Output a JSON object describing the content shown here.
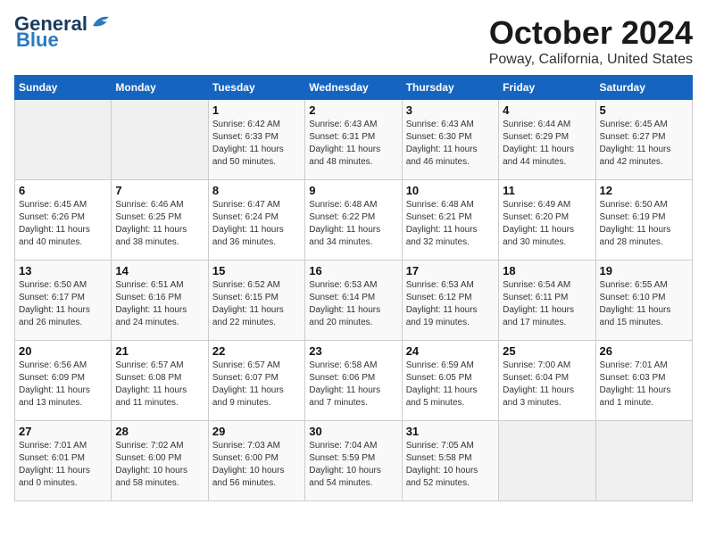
{
  "logo": {
    "line1": "General",
    "line2": "Blue"
  },
  "title": "October 2024",
  "subtitle": "Poway, California, United States",
  "days_of_week": [
    "Sunday",
    "Monday",
    "Tuesday",
    "Wednesday",
    "Thursday",
    "Friday",
    "Saturday"
  ],
  "weeks": [
    [
      {
        "day": "",
        "detail": ""
      },
      {
        "day": "",
        "detail": ""
      },
      {
        "day": "1",
        "detail": "Sunrise: 6:42 AM\nSunset: 6:33 PM\nDaylight: 11 hours\nand 50 minutes."
      },
      {
        "day": "2",
        "detail": "Sunrise: 6:43 AM\nSunset: 6:31 PM\nDaylight: 11 hours\nand 48 minutes."
      },
      {
        "day": "3",
        "detail": "Sunrise: 6:43 AM\nSunset: 6:30 PM\nDaylight: 11 hours\nand 46 minutes."
      },
      {
        "day": "4",
        "detail": "Sunrise: 6:44 AM\nSunset: 6:29 PM\nDaylight: 11 hours\nand 44 minutes."
      },
      {
        "day": "5",
        "detail": "Sunrise: 6:45 AM\nSunset: 6:27 PM\nDaylight: 11 hours\nand 42 minutes."
      }
    ],
    [
      {
        "day": "6",
        "detail": "Sunrise: 6:45 AM\nSunset: 6:26 PM\nDaylight: 11 hours\nand 40 minutes."
      },
      {
        "day": "7",
        "detail": "Sunrise: 6:46 AM\nSunset: 6:25 PM\nDaylight: 11 hours\nand 38 minutes."
      },
      {
        "day": "8",
        "detail": "Sunrise: 6:47 AM\nSunset: 6:24 PM\nDaylight: 11 hours\nand 36 minutes."
      },
      {
        "day": "9",
        "detail": "Sunrise: 6:48 AM\nSunset: 6:22 PM\nDaylight: 11 hours\nand 34 minutes."
      },
      {
        "day": "10",
        "detail": "Sunrise: 6:48 AM\nSunset: 6:21 PM\nDaylight: 11 hours\nand 32 minutes."
      },
      {
        "day": "11",
        "detail": "Sunrise: 6:49 AM\nSunset: 6:20 PM\nDaylight: 11 hours\nand 30 minutes."
      },
      {
        "day": "12",
        "detail": "Sunrise: 6:50 AM\nSunset: 6:19 PM\nDaylight: 11 hours\nand 28 minutes."
      }
    ],
    [
      {
        "day": "13",
        "detail": "Sunrise: 6:50 AM\nSunset: 6:17 PM\nDaylight: 11 hours\nand 26 minutes."
      },
      {
        "day": "14",
        "detail": "Sunrise: 6:51 AM\nSunset: 6:16 PM\nDaylight: 11 hours\nand 24 minutes."
      },
      {
        "day": "15",
        "detail": "Sunrise: 6:52 AM\nSunset: 6:15 PM\nDaylight: 11 hours\nand 22 minutes."
      },
      {
        "day": "16",
        "detail": "Sunrise: 6:53 AM\nSunset: 6:14 PM\nDaylight: 11 hours\nand 20 minutes."
      },
      {
        "day": "17",
        "detail": "Sunrise: 6:53 AM\nSunset: 6:12 PM\nDaylight: 11 hours\nand 19 minutes."
      },
      {
        "day": "18",
        "detail": "Sunrise: 6:54 AM\nSunset: 6:11 PM\nDaylight: 11 hours\nand 17 minutes."
      },
      {
        "day": "19",
        "detail": "Sunrise: 6:55 AM\nSunset: 6:10 PM\nDaylight: 11 hours\nand 15 minutes."
      }
    ],
    [
      {
        "day": "20",
        "detail": "Sunrise: 6:56 AM\nSunset: 6:09 PM\nDaylight: 11 hours\nand 13 minutes."
      },
      {
        "day": "21",
        "detail": "Sunrise: 6:57 AM\nSunset: 6:08 PM\nDaylight: 11 hours\nand 11 minutes."
      },
      {
        "day": "22",
        "detail": "Sunrise: 6:57 AM\nSunset: 6:07 PM\nDaylight: 11 hours\nand 9 minutes."
      },
      {
        "day": "23",
        "detail": "Sunrise: 6:58 AM\nSunset: 6:06 PM\nDaylight: 11 hours\nand 7 minutes."
      },
      {
        "day": "24",
        "detail": "Sunrise: 6:59 AM\nSunset: 6:05 PM\nDaylight: 11 hours\nand 5 minutes."
      },
      {
        "day": "25",
        "detail": "Sunrise: 7:00 AM\nSunset: 6:04 PM\nDaylight: 11 hours\nand 3 minutes."
      },
      {
        "day": "26",
        "detail": "Sunrise: 7:01 AM\nSunset: 6:03 PM\nDaylight: 11 hours\nand 1 minute."
      }
    ],
    [
      {
        "day": "27",
        "detail": "Sunrise: 7:01 AM\nSunset: 6:01 PM\nDaylight: 11 hours\nand 0 minutes."
      },
      {
        "day": "28",
        "detail": "Sunrise: 7:02 AM\nSunset: 6:00 PM\nDaylight: 10 hours\nand 58 minutes."
      },
      {
        "day": "29",
        "detail": "Sunrise: 7:03 AM\nSunset: 6:00 PM\nDaylight: 10 hours\nand 56 minutes."
      },
      {
        "day": "30",
        "detail": "Sunrise: 7:04 AM\nSunset: 5:59 PM\nDaylight: 10 hours\nand 54 minutes."
      },
      {
        "day": "31",
        "detail": "Sunrise: 7:05 AM\nSunset: 5:58 PM\nDaylight: 10 hours\nand 52 minutes."
      },
      {
        "day": "",
        "detail": ""
      },
      {
        "day": "",
        "detail": ""
      }
    ]
  ]
}
